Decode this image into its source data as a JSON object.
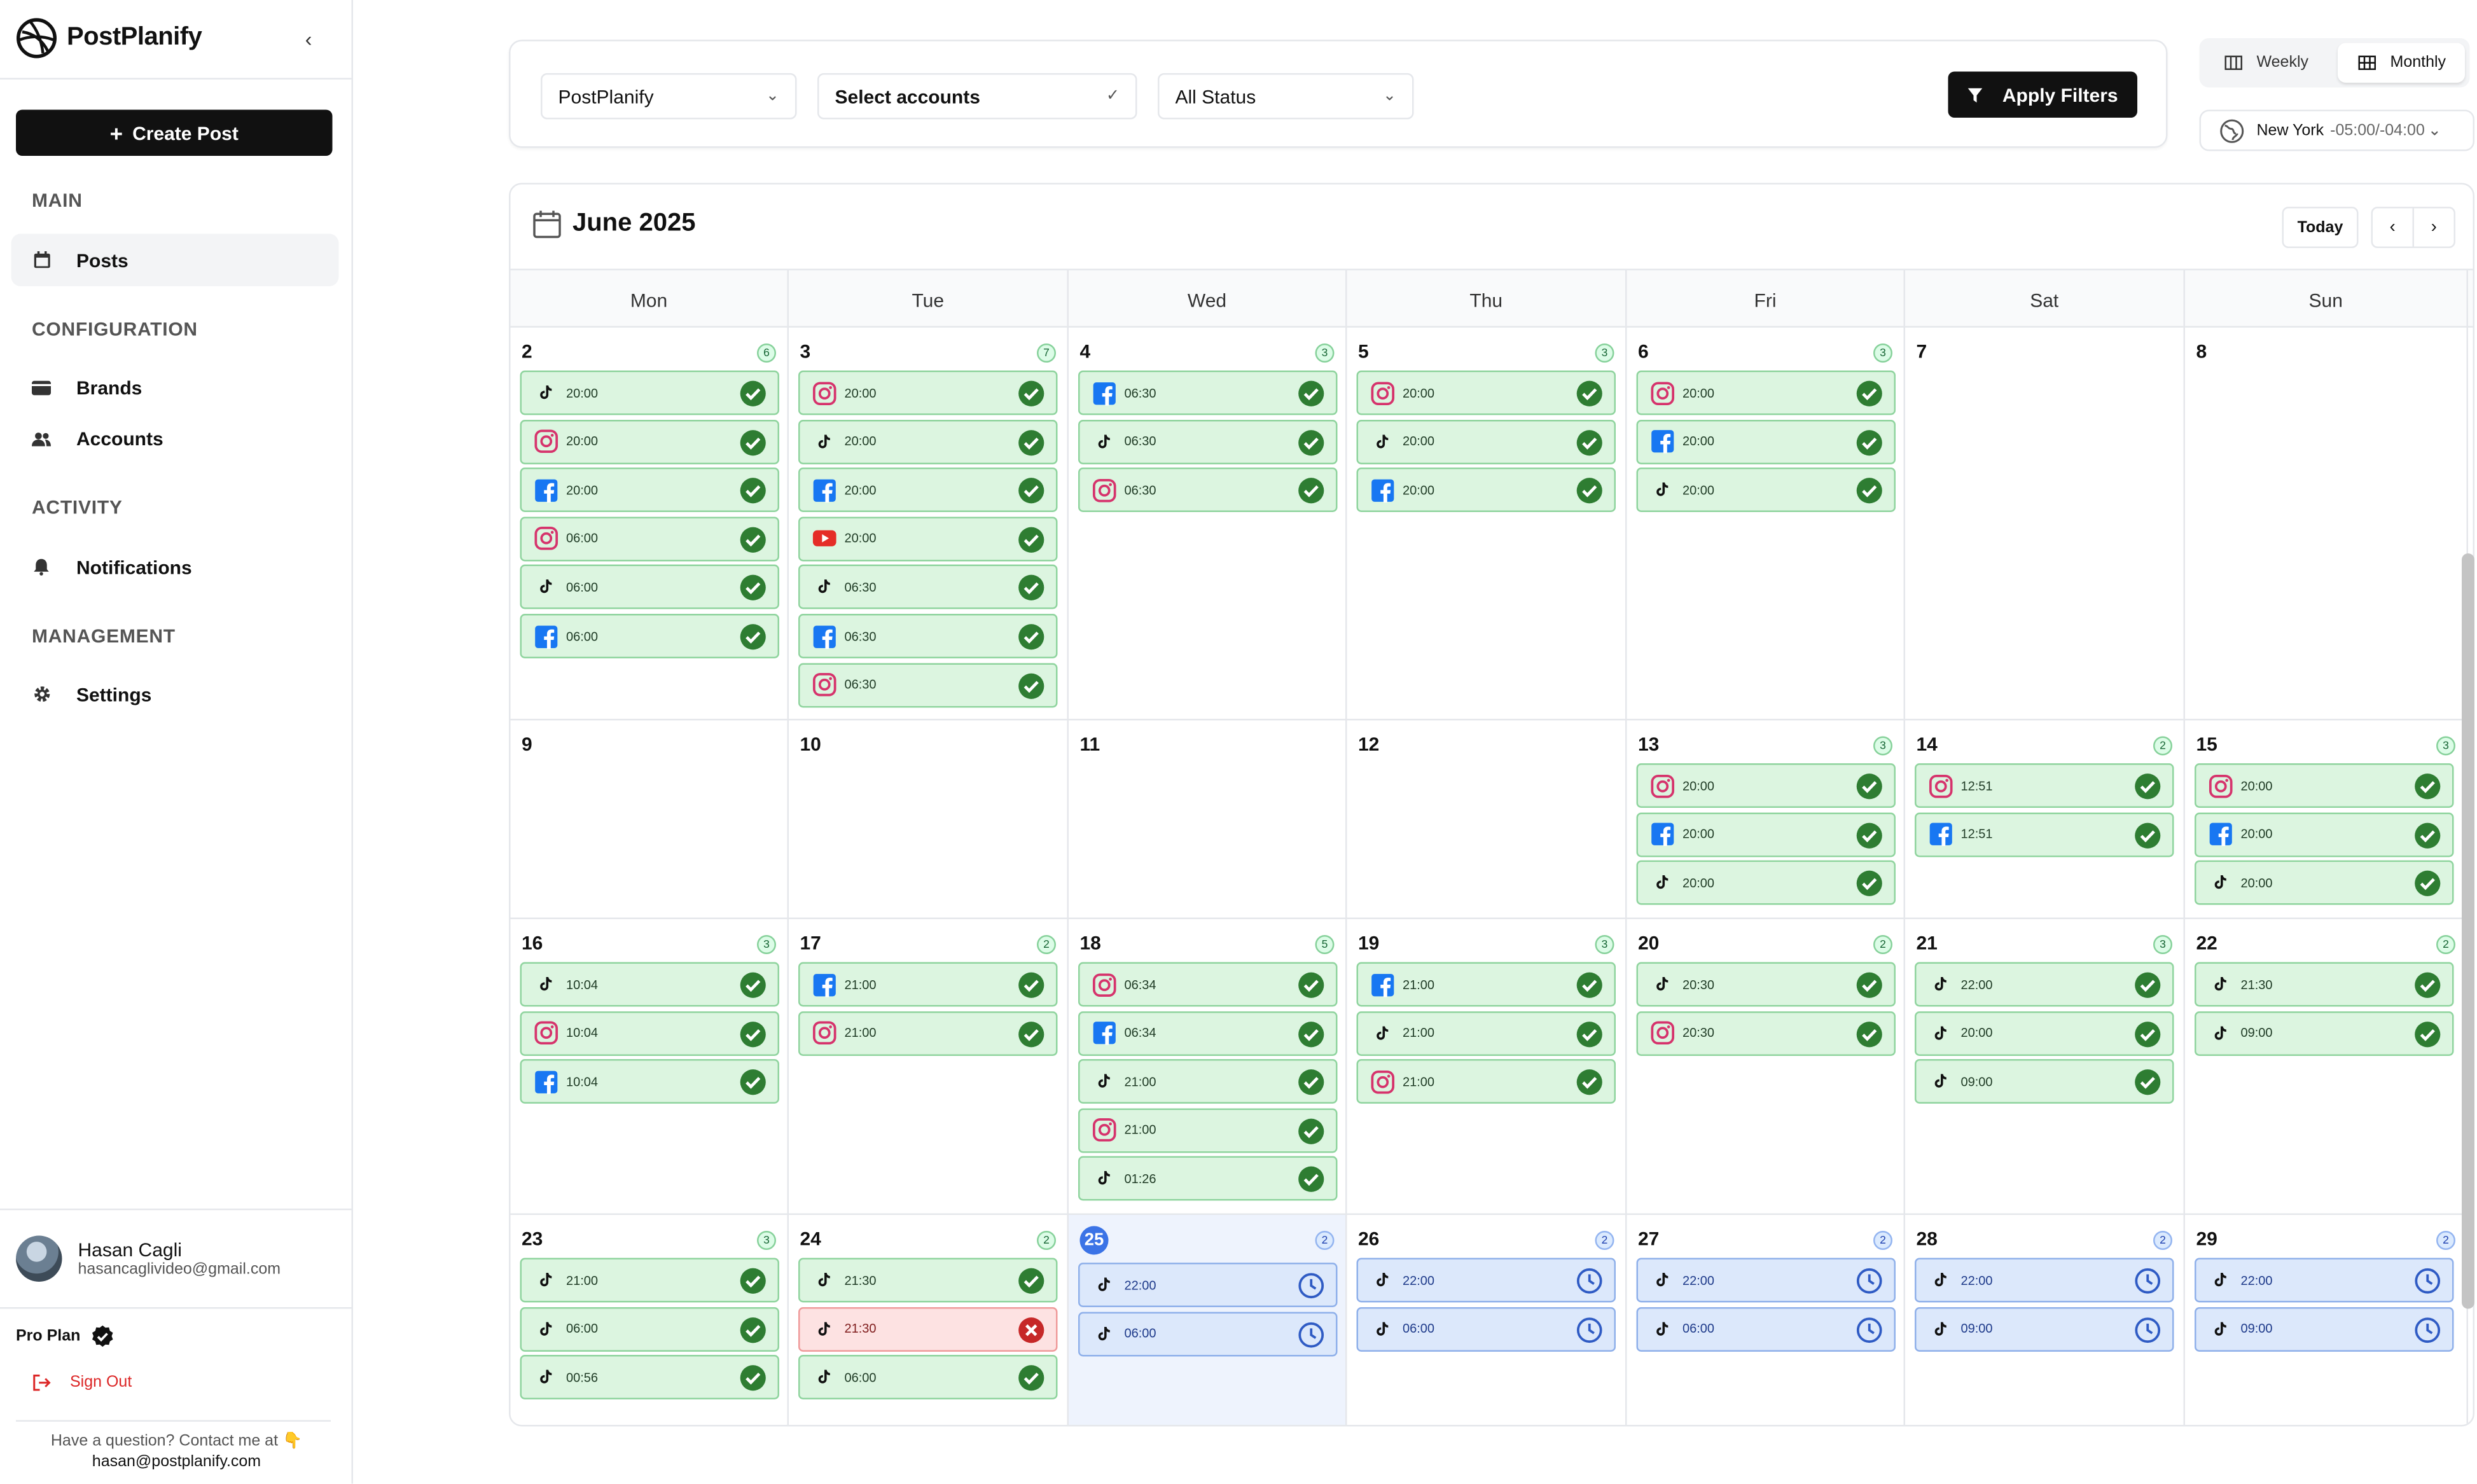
{
  "app": {
    "name": "PostPlanify",
    "logo_icon": "dribbble-style-logo",
    "collapse_label": "‹"
  },
  "sidebar": {
    "create_label": "Create Post",
    "sections": [
      {
        "title": "MAIN",
        "items": [
          {
            "label": "Posts",
            "icon": "calendar-icon",
            "active": true
          }
        ]
      },
      {
        "title": "CONFIGURATION",
        "items": [
          {
            "label": "Brands",
            "icon": "wallet-icon"
          },
          {
            "label": "Accounts",
            "icon": "users-icon"
          }
        ]
      },
      {
        "title": "ACTIVITY",
        "items": [
          {
            "label": "Notifications",
            "icon": "bell-icon"
          }
        ]
      },
      {
        "title": "MANAGEMENT",
        "items": [
          {
            "label": "Settings",
            "icon": "gear-icon"
          }
        ]
      }
    ],
    "user": {
      "name": "Hasan Cagli",
      "email": "hasancaglivideo@gmail.com"
    },
    "plan": "Pro Plan",
    "sign_out": "Sign Out",
    "help_line1": "Have a question? Contact me at 👇",
    "help_line2": "hasan@postplanify.com"
  },
  "filters": {
    "brand": "PostPlanify",
    "accounts": "Select accounts",
    "status": "All Status",
    "apply_label": "Apply Filters"
  },
  "view": {
    "weekly": "Weekly",
    "monthly": "Monthly",
    "active": "monthly"
  },
  "timezone": {
    "city": "New York",
    "offset": "-05:00/-04:00"
  },
  "calendar": {
    "month_label": "June 2025",
    "today_label": "Today",
    "weekdays": [
      "Mon",
      "Tue",
      "Wed",
      "Thu",
      "Fri",
      "Sat",
      "Sun"
    ],
    "weeks": [
      [
        {
          "day": "2",
          "count": "6",
          "events": [
            [
              "tiktok",
              "20:00",
              "ok"
            ],
            [
              "instagram",
              "20:00",
              "ok"
            ],
            [
              "facebook",
              "20:00",
              "ok"
            ],
            [
              "instagram",
              "06:00",
              "ok"
            ],
            [
              "tiktok",
              "06:00",
              "ok"
            ],
            [
              "facebook",
              "06:00",
              "ok"
            ]
          ]
        },
        {
          "day": "3",
          "count": "7",
          "events": [
            [
              "instagram",
              "20:00",
              "ok"
            ],
            [
              "tiktok",
              "20:00",
              "ok"
            ],
            [
              "facebook",
              "20:00",
              "ok"
            ],
            [
              "youtube",
              "20:00",
              "ok"
            ],
            [
              "tiktok",
              "06:30",
              "ok"
            ],
            [
              "facebook",
              "06:30",
              "ok"
            ],
            [
              "instagram",
              "06:30",
              "ok"
            ]
          ]
        },
        {
          "day": "4",
          "count": "3",
          "events": [
            [
              "facebook",
              "06:30",
              "ok"
            ],
            [
              "tiktok",
              "06:30",
              "ok"
            ],
            [
              "instagram",
              "06:30",
              "ok"
            ]
          ]
        },
        {
          "day": "5",
          "count": "3",
          "events": [
            [
              "instagram",
              "20:00",
              "ok"
            ],
            [
              "tiktok",
              "20:00",
              "ok"
            ],
            [
              "facebook",
              "20:00",
              "ok"
            ]
          ]
        },
        {
          "day": "6",
          "count": "3",
          "events": [
            [
              "instagram",
              "20:00",
              "ok"
            ],
            [
              "facebook",
              "20:00",
              "ok"
            ],
            [
              "tiktok",
              "20:00",
              "ok"
            ]
          ]
        },
        {
          "day": "7",
          "count": "",
          "events": []
        },
        {
          "day": "8",
          "count": "",
          "events": []
        }
      ],
      [
        {
          "day": "9",
          "count": "",
          "events": []
        },
        {
          "day": "10",
          "count": "",
          "events": []
        },
        {
          "day": "11",
          "count": "",
          "events": []
        },
        {
          "day": "12",
          "count": "",
          "events": []
        },
        {
          "day": "13",
          "count": "3",
          "events": [
            [
              "instagram",
              "20:00",
              "ok"
            ],
            [
              "facebook",
              "20:00",
              "ok"
            ],
            [
              "tiktok",
              "20:00",
              "ok"
            ]
          ]
        },
        {
          "day": "14",
          "count": "2",
          "events": [
            [
              "instagram",
              "12:51",
              "ok"
            ],
            [
              "facebook",
              "12:51",
              "ok"
            ]
          ]
        },
        {
          "day": "15",
          "count": "3",
          "events": [
            [
              "instagram",
              "20:00",
              "ok"
            ],
            [
              "facebook",
              "20:00",
              "ok"
            ],
            [
              "tiktok",
              "20:00",
              "ok"
            ]
          ]
        }
      ],
      [
        {
          "day": "16",
          "count": "3",
          "events": [
            [
              "tiktok",
              "10:04",
              "ok"
            ],
            [
              "instagram",
              "10:04",
              "ok"
            ],
            [
              "facebook",
              "10:04",
              "ok"
            ]
          ]
        },
        {
          "day": "17",
          "count": "2",
          "events": [
            [
              "facebook",
              "21:00",
              "ok"
            ],
            [
              "instagram",
              "21:00",
              "ok"
            ]
          ]
        },
        {
          "day": "18",
          "count": "5",
          "events": [
            [
              "instagram",
              "06:34",
              "ok"
            ],
            [
              "facebook",
              "06:34",
              "ok"
            ],
            [
              "tiktok",
              "21:00",
              "ok"
            ],
            [
              "instagram",
              "21:00",
              "ok"
            ],
            [
              "tiktok",
              "01:26",
              "ok"
            ]
          ]
        },
        {
          "day": "19",
          "count": "3",
          "events": [
            [
              "facebook",
              "21:00",
              "ok"
            ],
            [
              "tiktok",
              "21:00",
              "ok"
            ],
            [
              "instagram",
              "21:00",
              "ok"
            ]
          ]
        },
        {
          "day": "20",
          "count": "2",
          "events": [
            [
              "tiktok",
              "20:30",
              "ok"
            ],
            [
              "instagram",
              "20:30",
              "ok"
            ]
          ]
        },
        {
          "day": "21",
          "count": "3",
          "events": [
            [
              "tiktok",
              "22:00",
              "ok"
            ],
            [
              "tiktok",
              "20:00",
              "ok"
            ],
            [
              "tiktok",
              "09:00",
              "ok"
            ]
          ]
        },
        {
          "day": "22",
          "count": "2",
          "events": [
            [
              "tiktok",
              "21:30",
              "ok"
            ],
            [
              "tiktok",
              "09:00",
              "ok"
            ]
          ]
        }
      ],
      [
        {
          "day": "23",
          "count": "3",
          "events": [
            [
              "tiktok",
              "21:00",
              "ok"
            ],
            [
              "tiktok",
              "06:00",
              "ok"
            ],
            [
              "tiktok",
              "00:56",
              "ok"
            ]
          ]
        },
        {
          "day": "24",
          "count": "2",
          "events": [
            [
              "tiktok",
              "21:30",
              "ok"
            ],
            [
              "tiktok",
              "21:30",
              "fail"
            ],
            [
              "tiktok",
              "06:00",
              "ok"
            ]
          ]
        },
        {
          "day": "25",
          "count": "2",
          "today": true,
          "events": [
            [
              "tiktok",
              "22:00",
              "sched"
            ],
            [
              "tiktok",
              "06:00",
              "sched"
            ]
          ]
        },
        {
          "day": "26",
          "count": "2",
          "events": [
            [
              "tiktok",
              "22:00",
              "sched"
            ],
            [
              "tiktok",
              "06:00",
              "sched"
            ]
          ]
        },
        {
          "day": "27",
          "count": "2",
          "events": [
            [
              "tiktok",
              "22:00",
              "sched"
            ],
            [
              "tiktok",
              "06:00",
              "sched"
            ]
          ]
        },
        {
          "day": "28",
          "count": "2",
          "events": [
            [
              "tiktok",
              "22:00",
              "sched"
            ],
            [
              "tiktok",
              "09:00",
              "sched"
            ]
          ]
        },
        {
          "day": "29",
          "count": "2",
          "events": [
            [
              "tiktok",
              "22:00",
              "sched"
            ],
            [
              "tiktok",
              "09:00",
              "sched"
            ]
          ]
        }
      ]
    ]
  },
  "colors": {
    "success": "#2e7d32",
    "failed": "#c62828",
    "scheduled": "#2f5bc4",
    "instagram": "#d6336c",
    "facebook": "#1877f2",
    "youtube": "#e52d27"
  }
}
